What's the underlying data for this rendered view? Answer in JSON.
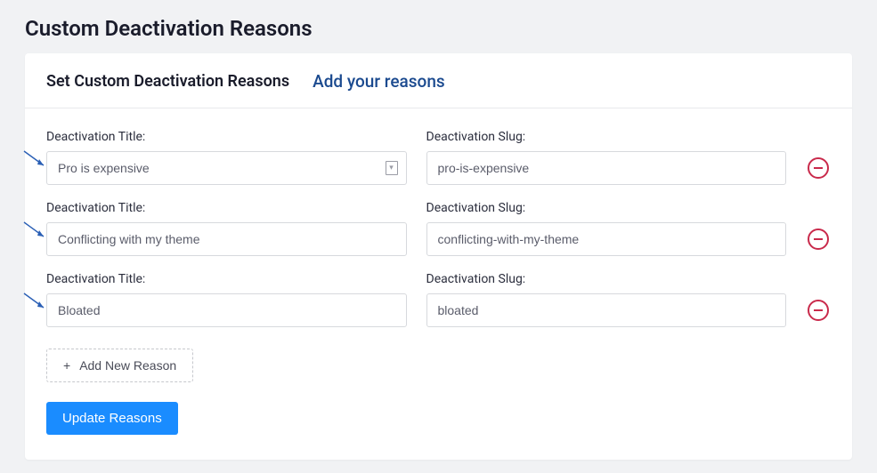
{
  "page_title": "Custom Deactivation Reasons",
  "panel": {
    "title": "Set Custom Deactivation Reasons",
    "link": "Add your reasons"
  },
  "labels": {
    "title": "Deactivation Title:",
    "slug": "Deactivation Slug:"
  },
  "reasons": [
    {
      "title": "Pro is expensive",
      "slug": "pro-is-expensive"
    },
    {
      "title": "Conflicting with my theme",
      "slug": "conflicting-with-my-theme"
    },
    {
      "title": "Bloated",
      "slug": "bloated"
    }
  ],
  "buttons": {
    "add_new": "Add New Reason",
    "update": "Update Reasons"
  }
}
